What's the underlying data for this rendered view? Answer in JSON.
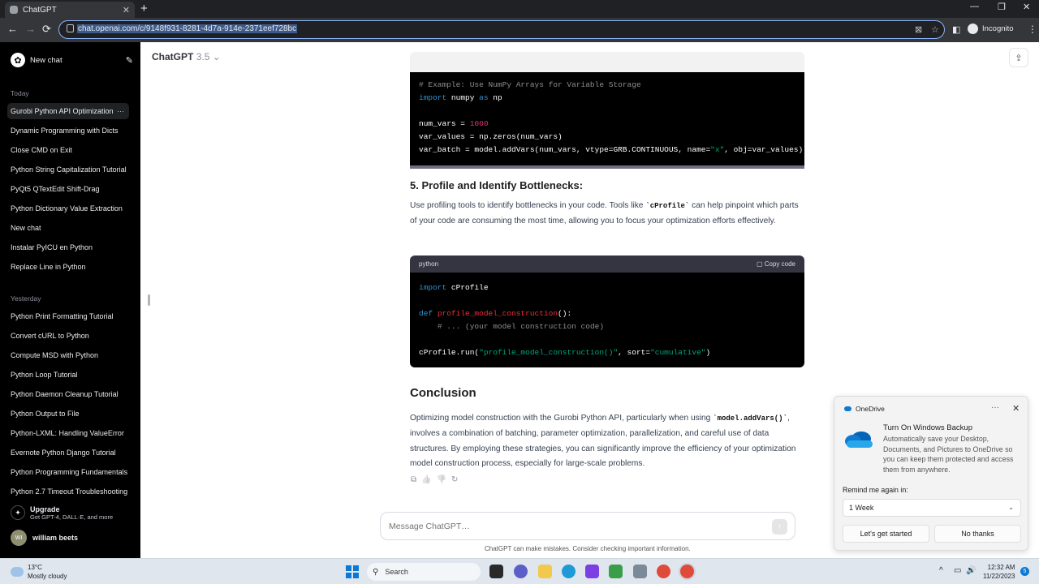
{
  "browser": {
    "tab_title": "ChatGPT",
    "tab_close": "✕",
    "new_tab": "+",
    "url": "chat.openai.com/c/9148f931-8281-4d7a-914e-2371eef728bc",
    "profile_label": "Incognito",
    "window_controls": [
      "—",
      "❐",
      "✕"
    ],
    "nav": [
      "←",
      "→",
      "⟳"
    ]
  },
  "sidebar": {
    "new_chat_label": "New chat",
    "sections": [
      {
        "label": "Today",
        "items": [
          "Gurobi Python API Optimization",
          "Dynamic Programming with Dicts",
          "Close CMD on Exit",
          "Python String Capitalization Tutorial",
          "PyQt5 QTextEdit Shift-Drag",
          "Python Dictionary Value Extraction",
          "New chat",
          "Instalar PyICU en Python",
          "Replace Line in Python"
        ]
      },
      {
        "label": "Yesterday",
        "items": [
          "Python Print Formatting Tutorial",
          "Convert cURL to Python",
          "Compute MSD with Python",
          "Python Loop Tutorial",
          "Python Daemon Cleanup Tutorial",
          "Python Output to File",
          "Python-LXML: Handling ValueError",
          "Evernote Python Django Tutorial",
          "Python Programming Fundamentals",
          "Python 2.7 Timeout Troubleshooting"
        ]
      }
    ],
    "item_menu": "···",
    "upgrade_title": "Upgrade",
    "upgrade_sub": "Get GPT-4, DALL·E, and more",
    "user_initials": "WI",
    "user_name": "william beets"
  },
  "header": {
    "model_name": "ChatGPT",
    "model_version": "3.5",
    "chevron": "⌄",
    "share_icon": "⇪"
  },
  "content": {
    "code1_lines": [
      [
        {
          "c": "cm",
          "t": "# Example: Use NumPy Arrays for Variable Storage"
        }
      ],
      [
        {
          "c": "kw",
          "t": "import"
        },
        {
          "c": "",
          "t": " numpy "
        },
        {
          "c": "kw",
          "t": "as"
        },
        {
          "c": "",
          "t": " np"
        }
      ],
      [
        {
          "c": "",
          "t": ""
        }
      ],
      [
        {
          "c": "",
          "t": "num_vars = "
        },
        {
          "c": "num",
          "t": "1000"
        }
      ],
      [
        {
          "c": "",
          "t": "var_values = np.zeros(num_vars)"
        }
      ],
      [
        {
          "c": "",
          "t": "var_batch = model.addVars(num_vars, vtype=GRB.CONTINUOUS, name="
        },
        {
          "c": "str",
          "t": "\"x\""
        },
        {
          "c": "",
          "t": ", obj=var_values)"
        }
      ]
    ],
    "section5_title": "5. Profile and Identify Bottlenecks:",
    "section5_pre": "Use profiling tools to identify bottlenecks in your code. Tools like ",
    "section5_code": "`cProfile`",
    "section5_post": " can help pinpoint which parts of your code are consuming the most time, allowing you to focus your optimization efforts effectively.",
    "code2_lang": "python",
    "code2_copy": "Copy code",
    "code2_lines": [
      [
        {
          "c": "kw",
          "t": "import"
        },
        {
          "c": "",
          "t": " cProfile"
        }
      ],
      [
        {
          "c": "",
          "t": ""
        }
      ],
      [
        {
          "c": "kw",
          "t": "def"
        },
        {
          "c": "",
          "t": " "
        },
        {
          "c": "fn",
          "t": "profile_model_construction"
        },
        {
          "c": "",
          "t": "():"
        }
      ],
      [
        {
          "c": "",
          "t": "    "
        },
        {
          "c": "cm",
          "t": "# ... (your model construction code)"
        }
      ],
      [
        {
          "c": "",
          "t": ""
        }
      ],
      [
        {
          "c": "",
          "t": "cProfile.run("
        },
        {
          "c": "str",
          "t": "\"profile_model_construction()\""
        },
        {
          "c": "",
          "t": ", sort="
        },
        {
          "c": "str",
          "t": "\"cumulative\""
        },
        {
          "c": "",
          "t": ")"
        }
      ]
    ],
    "conclusion_title": "Conclusion",
    "conclusion_pre": "Optimizing model construction with the Gurobi Python API, particularly when using ",
    "conclusion_code": "`model.addVars()`",
    "conclusion_post": ", involves a combination of batching, parameter optimization, parallelization, and careful use of data structures. By employing these strategies, you can significantly improve the efficiency of your optimization model construction process, especially for large-scale problems.",
    "action_icons": [
      "⧉",
      "👍",
      "👎",
      "↻"
    ]
  },
  "composer": {
    "placeholder": "Message ChatGPT…",
    "send_icon": "↑",
    "disclaimer": "ChatGPT can make mistakes. Consider checking important information."
  },
  "onedrive": {
    "app_name": "OneDrive",
    "menu": "···",
    "close": "✕",
    "title": "Turn On Windows Backup",
    "body": "Automatically save your Desktop, Documents, and Pictures to OneDrive so you can keep them protected and access them from anywhere.",
    "remind_label": "Remind me again in:",
    "remind_value": "1 Week",
    "primary_button": "Let's get started",
    "secondary_button": "No thanks",
    "accent": "#0f78d4"
  },
  "taskbar": {
    "temperature": "13°C",
    "weather": "Mostly cloudy",
    "search_label": "Search",
    "time": "12:32 AM",
    "date": "11/22/2023",
    "notification_count": "5",
    "tray_icons": [
      "^",
      "▭",
      "🔊",
      "🔋"
    ]
  }
}
